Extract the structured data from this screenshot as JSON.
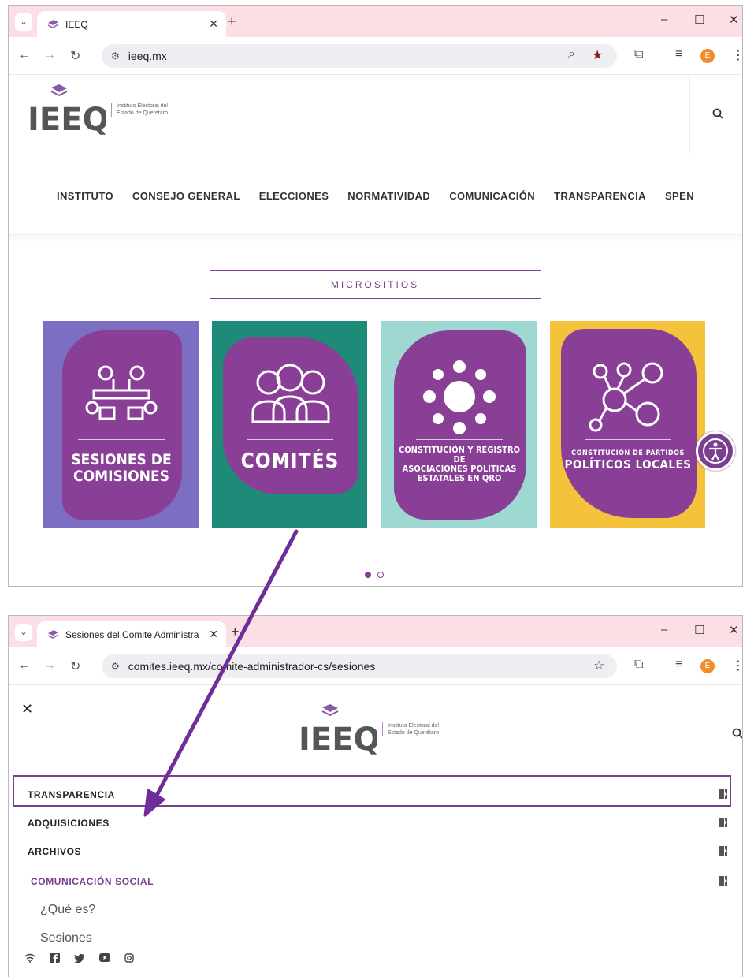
{
  "top_browser": {
    "tab_title": "IEEQ",
    "url": "ieeq.mx"
  },
  "bottom_browser": {
    "tab_title": "Sesiones del Comité Administra",
    "url": "comites.ieeq.mx/comite-administrador-cs/sesiones"
  },
  "avatar_letter": "E",
  "logo": {
    "mark": "IEEQ",
    "line1": "Instituto Electoral del",
    "line2": "Estado de Querétaro"
  },
  "main_menu": [
    "INSTITUTO",
    "CONSEJO GENERAL",
    "ELECCIONES",
    "NORMATIVIDAD",
    "COMUNICACIÓN",
    "TRANSPARENCIA",
    "SPEN"
  ],
  "microsites_title": "MICROSITIOS",
  "cards": [
    {
      "line1": "SESIONES DE",
      "line2": "COMISIONES"
    },
    {
      "line1": "COMITÉS",
      "line2": ""
    },
    {
      "line1": "CONSTITUCIÓN Y REGISTRO DE",
      "line2": "ASOCIACIONES POLÍTICAS",
      "line3": "ESTATALES EN QRO"
    },
    {
      "line1": "CONSTITUCIÓN DE PARTIDOS",
      "line2": "POLÍTICOS LOCALES"
    }
  ],
  "carousel": {
    "pages": 2,
    "active": 1
  },
  "side_menu": {
    "items": [
      "TRANSPARENCIA",
      "ADQUISICIONES",
      "ARCHIVOS",
      "COMUNICACIÓN SOCIAL"
    ],
    "subitems": [
      "¿Qué es?",
      "Sesiones"
    ]
  },
  "colors": {
    "brand_purple": "#7b3f8f",
    "tab_bar": "#fbdfe5",
    "card1_bg": "#7c6fc3",
    "card2_bg": "#1e8a78",
    "card3_bg": "#9fd8d2",
    "card4_bg": "#f5c33b"
  },
  "icons": [
    "close-icon",
    "search-icon",
    "expand-icon",
    "wifi-icon",
    "facebook-icon",
    "twitter-icon",
    "youtube-icon",
    "instagram-icon",
    "accessibility-icon"
  ]
}
